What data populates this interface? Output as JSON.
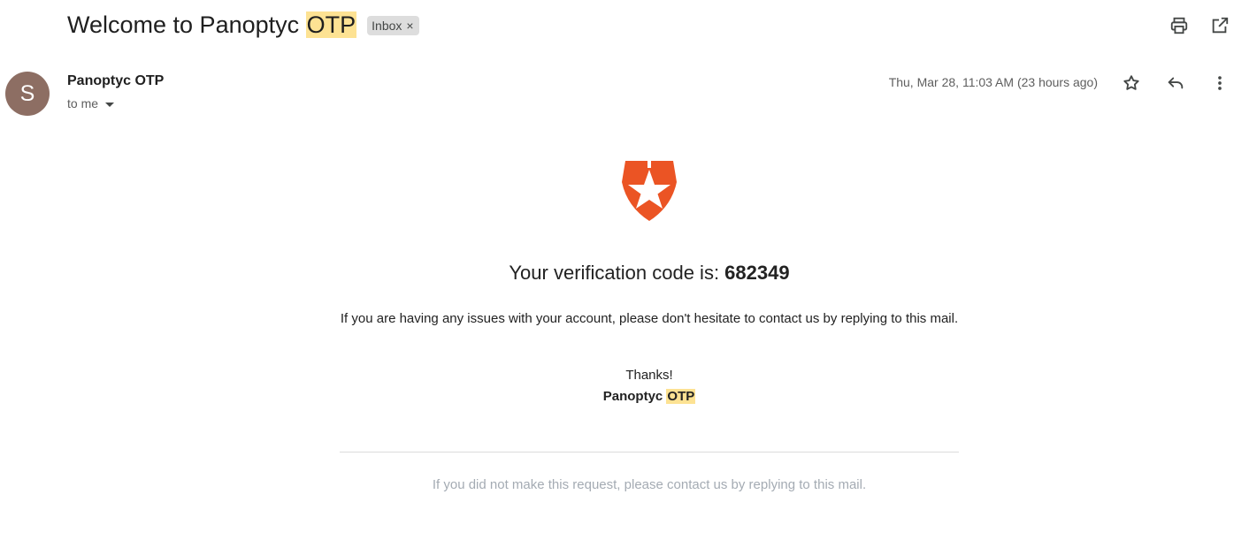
{
  "header": {
    "subject_prefix": "Welcome to Panoptyc ",
    "subject_highlight": "OTP",
    "label": "Inbox",
    "label_remove": "×",
    "actions": [
      "print-icon",
      "open-in-new-window-icon"
    ]
  },
  "message": {
    "avatar_letter": "S",
    "sender": "Panoptyc OTP",
    "recipient": "to me",
    "timestamp": "Thu, Mar 28, 11:03 AM (23 hours ago)",
    "actions": [
      "star-icon",
      "reply-icon",
      "more-vert-icon"
    ]
  },
  "body": {
    "logo": "shield-star-logo",
    "code_prefix": "Your verification code is: ",
    "code": "682349",
    "issues_text": "If you are having any issues with your account, please don't hesitate to contact us by replying to this mail.",
    "thanks": "Thanks!",
    "signature_prefix": "Panoptyc ",
    "signature_highlight": "OTP",
    "footer": "If you did not make this request, please contact us by replying to this mail."
  },
  "colors": {
    "highlight": "#fde293",
    "avatar": "#8d6e63",
    "logo": "#eb5424",
    "footer_text": "#a4abb3"
  }
}
